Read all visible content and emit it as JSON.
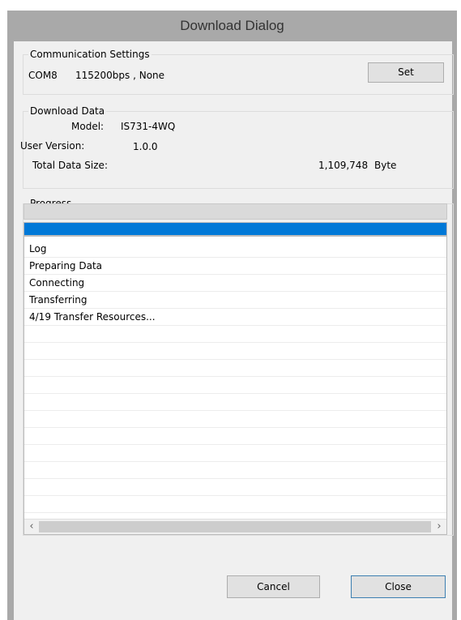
{
  "dialog": {
    "title": "Download Dialog"
  },
  "communication": {
    "legend": "Communication Settings",
    "port": "COM8",
    "settings": "115200bps , None",
    "set_label": "Set"
  },
  "download": {
    "legend": "Download Data",
    "model_label": "Model:",
    "model_value": "IS731-4WQ",
    "version_label": "User Version:",
    "version_value": "1.0.0",
    "size_label": "Total Data Size:",
    "size_value": "1,109,748",
    "size_unit": "Byte"
  },
  "progress": {
    "legend": "Progress",
    "fill_fraction": 1.0,
    "accent": "#0078d7"
  },
  "log": {
    "header": "Log",
    "entries": [
      "Preparing Data",
      "Connecting",
      "Transferring",
      "4/19 Transfer Resources..."
    ]
  },
  "scrollbar": {
    "left_icon": "chevron-left-icon",
    "right_icon": "chevron-right-icon"
  },
  "buttons": {
    "cancel_label": "Cancel",
    "close_label": "Close"
  }
}
